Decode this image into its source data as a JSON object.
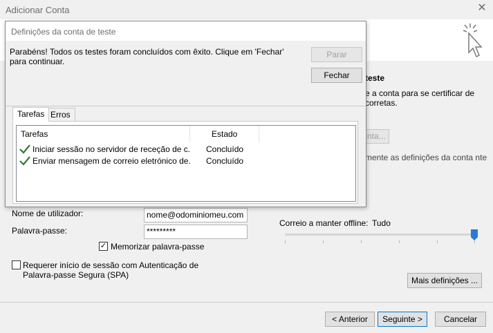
{
  "window": {
    "title": "Adicionar Conta"
  },
  "right_panel": {
    "test_heading": "teste",
    "test_desc": "e a conta para se certificar de corretas.",
    "test_button": "nta...",
    "auto_test_text": "mente as definições da conta nte"
  },
  "login": {
    "username_label": "Nome de utilizador:",
    "username_value": "nome@odominiomeu.com",
    "password_label": "Palavra-passe:",
    "password_value": "*********",
    "remember_label": "Memorizar palavra-passe",
    "remember_checked": true,
    "spa_label": "Requerer início de sessão com Autenticação de Palavra-passe Segura (SPA)",
    "spa_checked": false
  },
  "offline": {
    "label": "Correio a manter offline:",
    "value": "Tudo",
    "slider_position": 1.0
  },
  "more_settings_button": "Mais definições ...",
  "footer": {
    "back": "< Anterior",
    "next": "Seguinte >",
    "cancel": "Cancelar"
  },
  "dialog": {
    "title": "Definições da conta de teste",
    "message": "Parabéns! Todos os testes foram concluídos com êxito. Clique em 'Fechar' para continuar.",
    "stop_button": "Parar",
    "close_button": "Fechar",
    "tabs": [
      {
        "label": "Tarefas",
        "active": true
      },
      {
        "label": "Erros",
        "active": false
      }
    ],
    "columns": [
      "Tarefas",
      "Estado"
    ],
    "rows": [
      {
        "task": "Iniciar sessão no servidor de receção de c...",
        "status": "Concluído"
      },
      {
        "task": "Enviar mensagem de correio eletrónico de...",
        "status": "Concluído"
      }
    ],
    "check_color": "#2e7d32"
  }
}
